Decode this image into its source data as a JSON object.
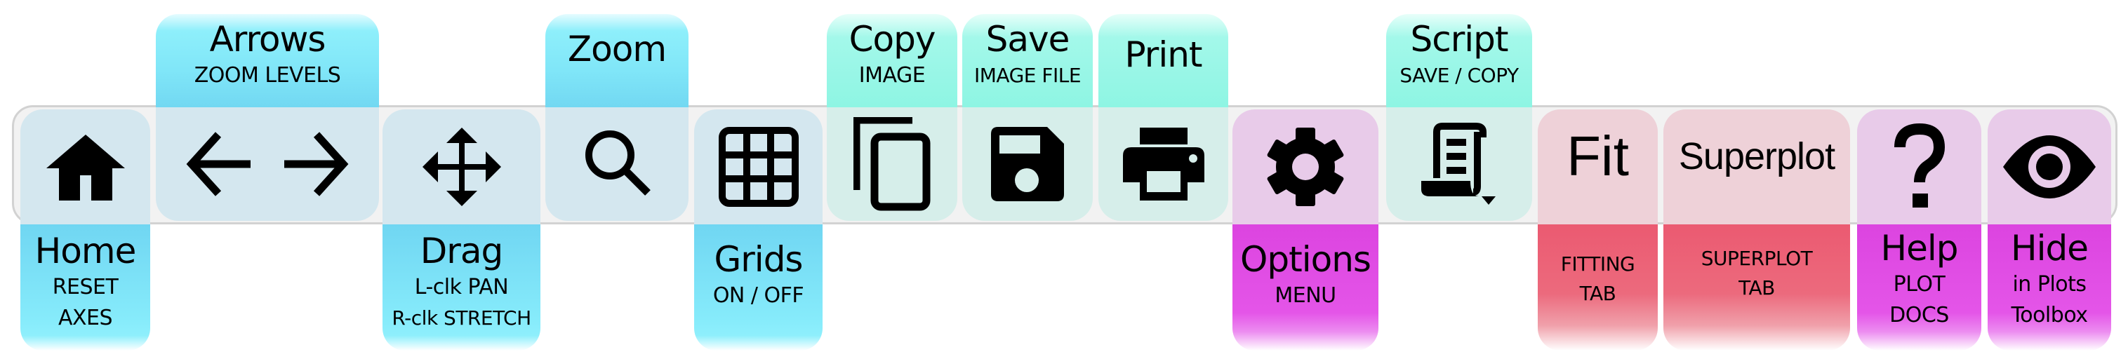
{
  "toolbar": {
    "items": [
      {
        "id": "home",
        "title": "Home",
        "subtitle": [
          "RESET",
          "AXES"
        ],
        "icon": "home-icon",
        "color_group": "blue",
        "label_position": "bottom"
      },
      {
        "id": "arrows",
        "title": "Arrows",
        "subtitle": [
          "ZOOM LEVELS"
        ],
        "icon": "arrow-left-right-icon",
        "color_group": "blue",
        "label_position": "top"
      },
      {
        "id": "drag",
        "title": "Drag",
        "subtitle": [
          "L-clk PAN",
          "R-clk STRETCH"
        ],
        "icon": "move-icon",
        "color_group": "blue",
        "label_position": "bottom"
      },
      {
        "id": "zoom",
        "title": "Zoom",
        "subtitle": [],
        "icon": "search-icon",
        "color_group": "blue",
        "label_position": "top"
      },
      {
        "id": "grids",
        "title": "Grids",
        "subtitle": [
          "ON / OFF"
        ],
        "icon": "grid-icon",
        "color_group": "blue",
        "label_position": "bottom"
      },
      {
        "id": "copy",
        "title": "Copy",
        "subtitle": [
          "IMAGE"
        ],
        "icon": "copy-icon",
        "color_group": "teal",
        "label_position": "top"
      },
      {
        "id": "save",
        "title": "Save",
        "subtitle": [
          "IMAGE FILE"
        ],
        "icon": "floppy-disk-icon",
        "color_group": "teal",
        "label_position": "top"
      },
      {
        "id": "print",
        "title": "Print",
        "subtitle": [],
        "icon": "printer-icon",
        "color_group": "teal",
        "label_position": "top"
      },
      {
        "id": "options",
        "title": "Options",
        "subtitle": [
          "MENU"
        ],
        "icon": "gear-icon",
        "color_group": "magenta",
        "label_position": "bottom"
      },
      {
        "id": "script",
        "title": "Script",
        "subtitle": [
          "SAVE / COPY"
        ],
        "icon": "script-scroll-dropdown-icon",
        "color_group": "teal",
        "label_position": "top"
      },
      {
        "id": "fit",
        "button_text": "Fit",
        "subtitle": [
          "FITTING",
          "TAB"
        ],
        "color_group": "red",
        "label_position": "bottom"
      },
      {
        "id": "superplot",
        "button_text": "Superplot",
        "subtitle": [
          "SUPERPLOT",
          "TAB"
        ],
        "color_group": "red",
        "label_position": "bottom"
      },
      {
        "id": "help",
        "title": "Help",
        "subtitle": [
          "PLOT",
          "DOCS"
        ],
        "icon": "question-mark-icon",
        "color_group": "magenta",
        "label_position": "bottom"
      },
      {
        "id": "hide",
        "title": "Hide",
        "subtitle": [
          "in Plots",
          "Toolbox"
        ],
        "icon": "eye-icon",
        "color_group": "magenta",
        "label_position": "bottom"
      }
    ]
  },
  "colors": {
    "blue_tab": "#72d8f2",
    "blue_cell": "#d4e7ef",
    "teal_tab": "#8ef5e3",
    "teal_cell": "#d6eeea",
    "magenta_tab": "#dc44e0",
    "magenta_cell": "#e8cbe9",
    "red_tab": "#eb5a71",
    "red_cell": "#eed1d8",
    "bar_background": "#f2f2f2",
    "bar_border": "#d2d2d2"
  }
}
